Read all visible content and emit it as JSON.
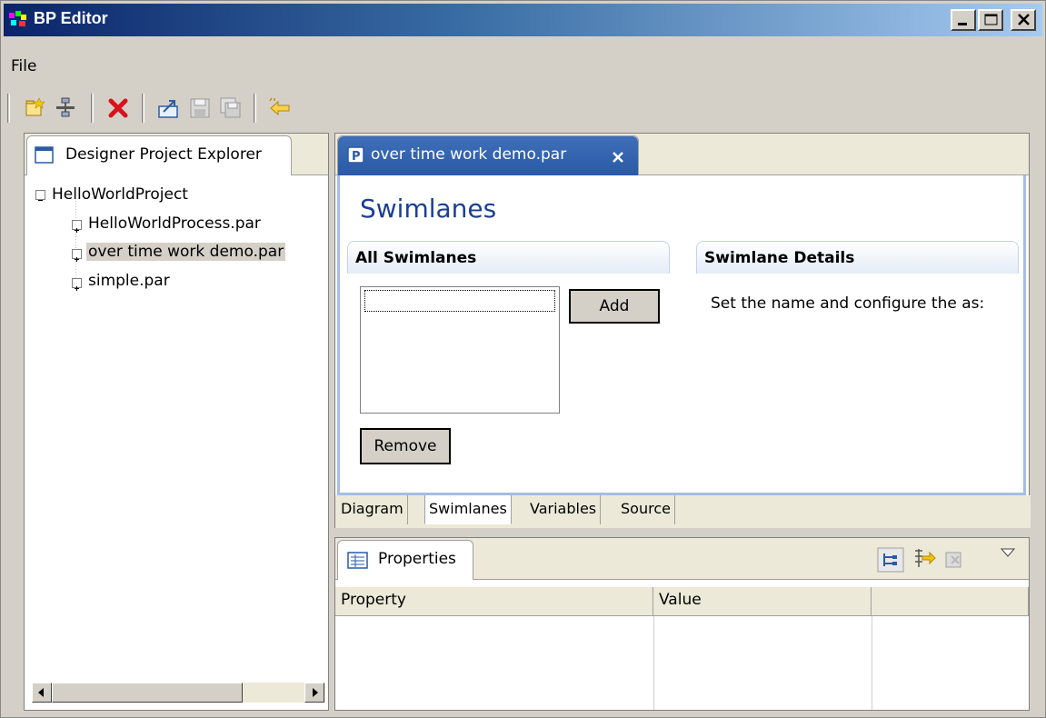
{
  "window": {
    "title": "BP Editor",
    "controls": [
      "minimize",
      "maximize",
      "close"
    ]
  },
  "menu": {
    "file": "File"
  },
  "toolbar": {
    "icons": [
      "new-project-icon",
      "new-process-icon",
      "delete-icon",
      "export-icon",
      "save-icon",
      "save-all-icon",
      "back-icon"
    ]
  },
  "explorer": {
    "title": "Designer Project Explorer",
    "tree": {
      "root": "HelloWorldProject",
      "children": [
        "HelloWorldProcess.par",
        "over time work demo.par",
        "simple.par"
      ],
      "selected_index": 1
    }
  },
  "editor": {
    "tab_label": "over time work demo.par",
    "heading": "Swimlanes",
    "all_swimlanes": {
      "header": "All Swimlanes",
      "add_label": "Add",
      "remove_label": "Remove",
      "items": []
    },
    "details": {
      "header": "Swimlane Details",
      "description": "Set the name and configure the as:"
    },
    "page_tabs": [
      "Diagram",
      "Swimlanes",
      "Variables",
      "Source"
    ],
    "active_page_tab": "Swimlanes"
  },
  "properties": {
    "title": "Properties",
    "columns": [
      "Property",
      "Value",
      ""
    ],
    "rows": []
  },
  "colors": {
    "title_gradient_start": "#0a246a",
    "title_gradient_end": "#a6caf0",
    "editor_tab": "#2f5faf",
    "heading_text": "#1c3f94",
    "window_bg": "#d4d0c8"
  }
}
